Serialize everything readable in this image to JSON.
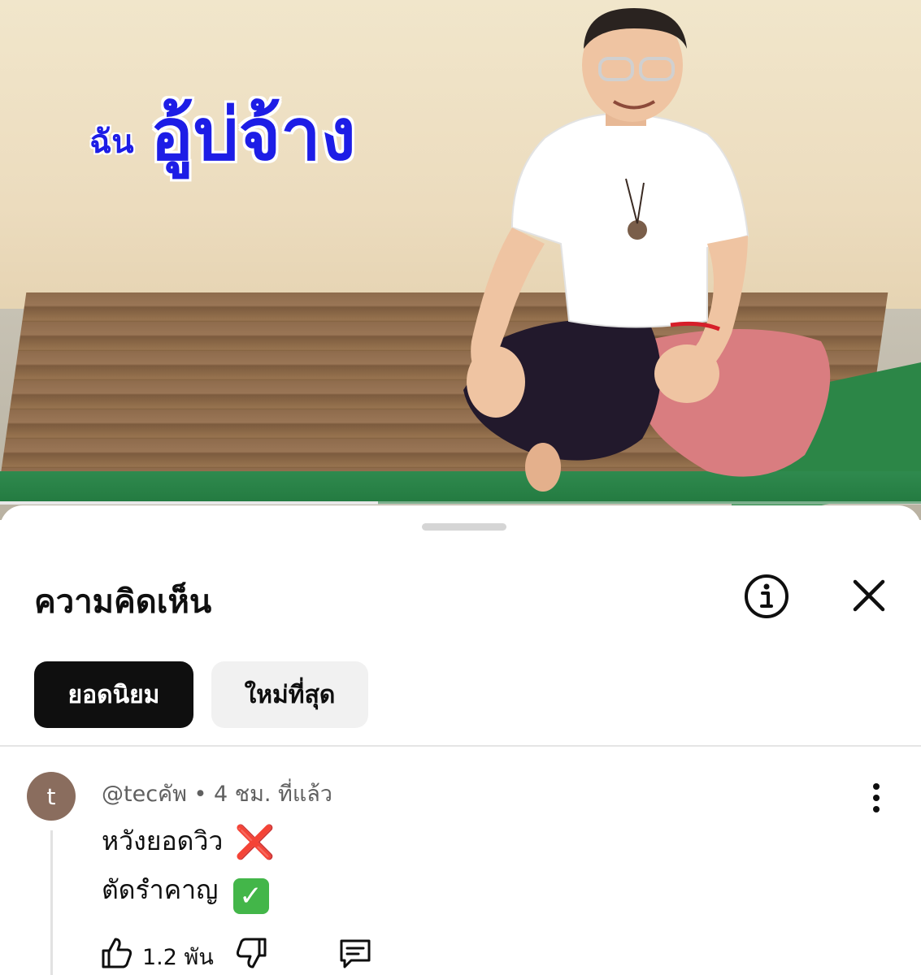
{
  "video": {
    "overlay_small": "ฉัน",
    "overlay_big": "อู้บ่จ้าง",
    "progress": 0.41
  },
  "comments": {
    "title": "ความคิดเห็น",
    "filters": [
      {
        "label": "ยอดนิยม",
        "active": true
      },
      {
        "label": "ใหม่ที่สุด",
        "active": false
      }
    ],
    "items": [
      {
        "avatar_letter": "t",
        "meta": "@tecคัพ • 4 ชม. ที่แล้ว",
        "line1": "หวังยอดวิว",
        "line1_emoji": "❌",
        "line2": "ตัดรำคาญ",
        "line2_emoji": "✓",
        "likes": "1.2 พัน"
      }
    ]
  },
  "icons": [
    "info-icon",
    "close-icon",
    "more-vertical-icon",
    "thumbs-up-icon",
    "thumbs-down-icon",
    "reply-icon"
  ],
  "colors": {
    "overlay_text": "#1d1de6",
    "active_chip": "#0f0f0f",
    "inactive_chip": "#f1f1f1",
    "avatar": "#8a6d5e"
  }
}
